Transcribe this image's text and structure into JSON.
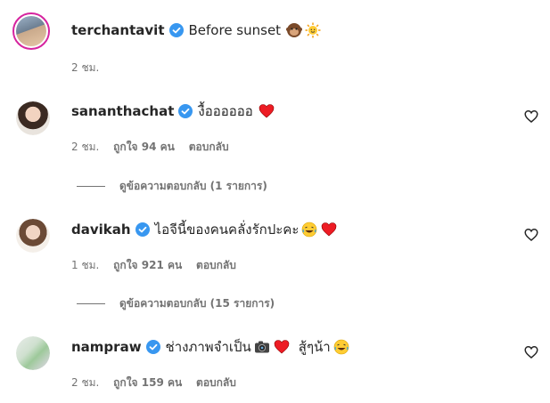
{
  "caption": {
    "username": "terchantavit",
    "text": "Before sunset",
    "emojis": [
      "monkey-emoji",
      "sun-emoji"
    ],
    "time": "2 ชม."
  },
  "comments": [
    {
      "username": "sananthachat",
      "text": "งื้ออออออ",
      "emojis_after": [
        "red-heart-emoji"
      ],
      "time": "2 ชม.",
      "likes": "ถูกใจ 94 คน",
      "reply_label": "ตอบกลับ",
      "view_replies": "ดูข้อความตอบกลับ (1 รายการ)"
    },
    {
      "username": "davikah",
      "text": "ไอจีนี้ของคนคลั่งรักปะคะ",
      "emojis_after": [
        "laughing-emoji",
        "red-heart-emoji"
      ],
      "time": "1 ชม.",
      "likes": "ถูกใจ 921 คน",
      "reply_label": "ตอบกลับ",
      "view_replies": "ดูข้อความตอบกลับ (15 รายการ)"
    },
    {
      "username": "nampraw",
      "text": "ช่างภาพจำเป็น",
      "text2": "สู้ๆน้า",
      "time": "2 ชม.",
      "likes": "ถูกใจ 159 คน",
      "reply_label": "ตอบกลับ"
    }
  ],
  "colors": {
    "primary_text": "#262626",
    "secondary_text": "#737373",
    "verified_blue": "#3897f0",
    "heart_red": "#ed1c24",
    "story_ring": "#d6249f"
  }
}
